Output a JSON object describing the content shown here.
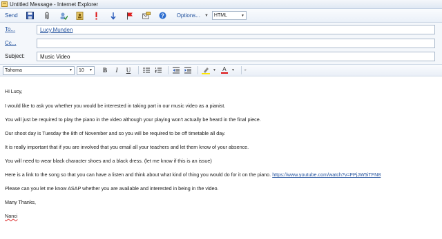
{
  "window": {
    "title": "Untitled Message - Internet Explorer"
  },
  "toolbar": {
    "send_label": "Send",
    "options_label": "Options...",
    "format_value": "HTML",
    "icons": [
      "save-icon",
      "attach-icon",
      "check-names-icon",
      "address-book-icon",
      "importance-high-icon",
      "importance-low-icon",
      "flag-icon",
      "message-options-icon",
      "help-icon"
    ]
  },
  "fields": {
    "to_label": "To...",
    "to_value": "Lucy.Munden",
    "cc_label": "Cc...",
    "cc_value": "",
    "subject_label": "Subject:",
    "subject_value": "Music Video"
  },
  "formatting": {
    "font_value": "Tahoma",
    "size_value": "10",
    "bold": "B",
    "italic": "I",
    "underline": "U",
    "font_color_letter": "A"
  },
  "message": {
    "greeting": "Hi Lucy,",
    "p1": "I would like to ask you whether you would be interested in taking part in  our music video as a pianist.",
    "p2": "You will just be required to play the piano in the video although your playing won't actually be heard in the final piece.",
    "p3": "Our shoot day is Tuesday the 8th of November and so you will be required to be off timetable all day.",
    "p4": "It is really important that if you are involved that you email all your teachers and let them know of your absence.",
    "p5": "You will need to wear black character shoes and a black dress. (let me know if this is an issue)",
    "p6": "Here is a link to the song so that you can have a listen and think about what kind of thing you would do for it on the piano. ",
    "link": "https://www.youtube.com/watch?v=FPjJW5iTFN8",
    "p7": "Please can you let me know ASAP whether you are available and interested in being in the video.",
    "closing": "Many Thanks,",
    "signature": "Nanci"
  }
}
